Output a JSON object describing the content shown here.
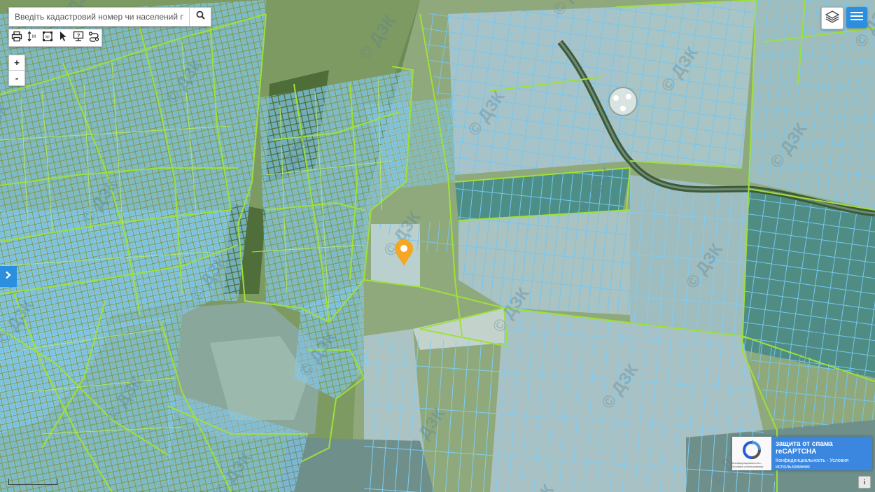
{
  "search": {
    "placeholder": "Введіть кадастровий номер чи населений пункт",
    "value": ""
  },
  "icons": {
    "search": "search-icon",
    "toolbar": [
      "print-icon",
      "measure-distance-icon",
      "measure-area-icon",
      "select-pointer-icon",
      "info-identify-icon",
      "route-icon"
    ],
    "layers": "layers-icon",
    "menu": "hamburger-menu-icon",
    "side_toggle": "chevron-right-icon",
    "marker": "map-pin-icon",
    "info": "info-icon"
  },
  "zoom": {
    "in_label": "+",
    "out_label": "-"
  },
  "watermark": {
    "text": "© ДЗК"
  },
  "recaptcha": {
    "title": "защита от спама reCAPTCHA",
    "links": "Конфиденциальность - Условия использования",
    "mini": "Конфиденциальность - Условия использования"
  },
  "info_button": {
    "label": "i"
  },
  "colors": {
    "accent": "#2b8fe0",
    "parcel_outline": "#6ec8f5",
    "boundary": "#9ee03a",
    "marker": "#f5a623",
    "recaptcha_blue": "#3b87e0"
  }
}
